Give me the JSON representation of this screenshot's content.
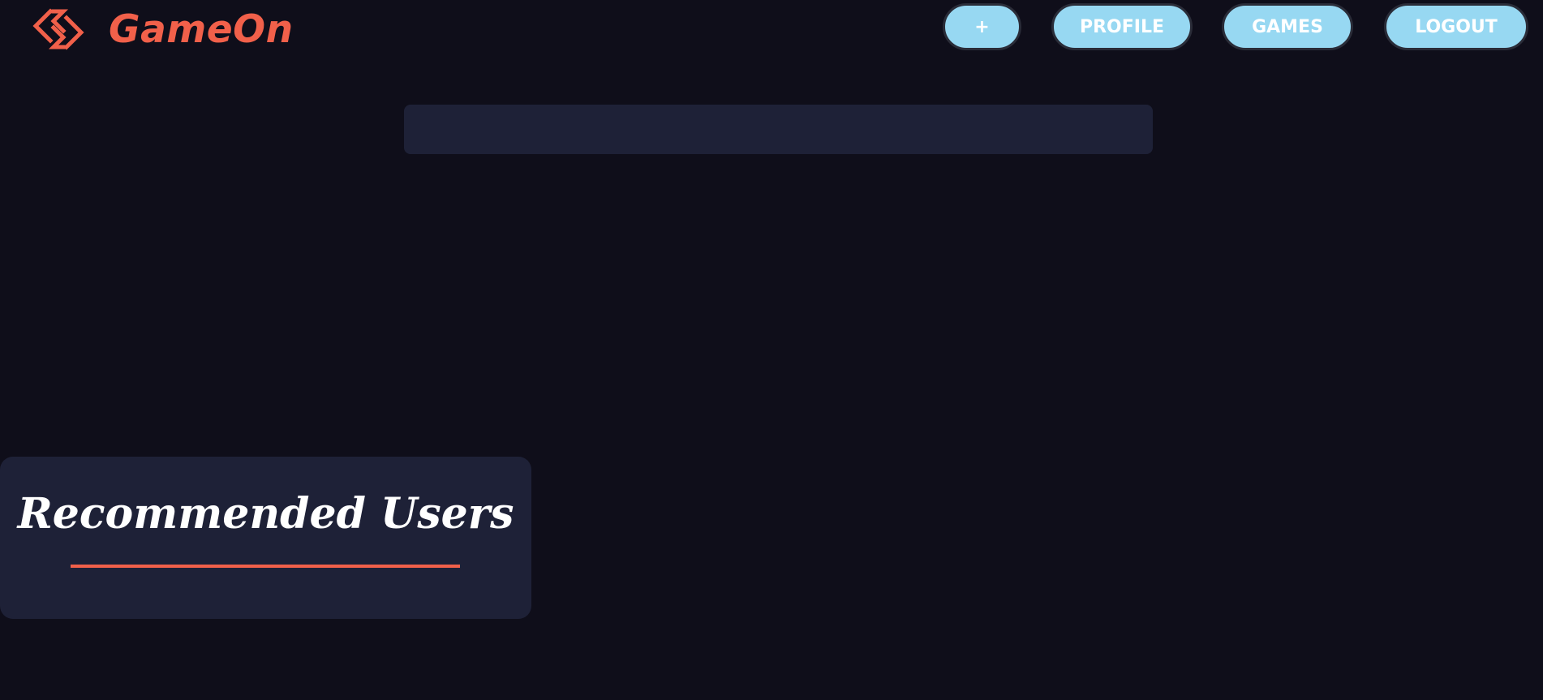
{
  "header": {
    "brand_name": "GameOn",
    "brand_icon": "gameon-logo-icon",
    "nav": {
      "add_label": "+",
      "profile_label": "PROFILE",
      "games_label": "GAMES",
      "logout_label": "LOGOUT"
    }
  },
  "search": {
    "value": "",
    "placeholder": ""
  },
  "recommended": {
    "title": "Recommended Users"
  },
  "colors": {
    "background": "#0f0e1a",
    "panel": "#1e2137",
    "accent": "#f1604a",
    "button": "#97d8f2"
  }
}
